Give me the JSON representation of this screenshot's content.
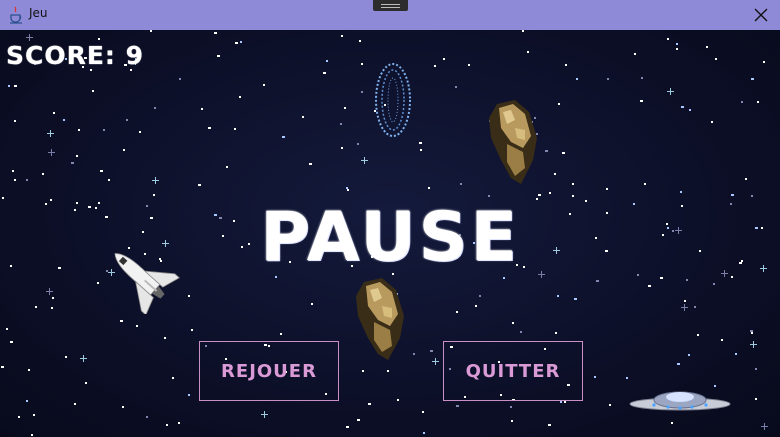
{
  "window": {
    "title": "Jeu",
    "close_glyph": "✕"
  },
  "hud": {
    "score_label": "SCORE:",
    "score_value": "9"
  },
  "overlay": {
    "heading": "PAUSE",
    "replay_label": "REJOUER",
    "quit_label": "QUITTER"
  },
  "sprites": [
    "space-shuttle-icon",
    "asteroid-icon",
    "asteroid-icon",
    "portal-ring-icon",
    "ufo-icon"
  ],
  "colors": {
    "titlebar": "#8f8ad8",
    "background": "#0b0d22",
    "button_text": "#d99ad6",
    "button_border": "#c98fc6"
  }
}
